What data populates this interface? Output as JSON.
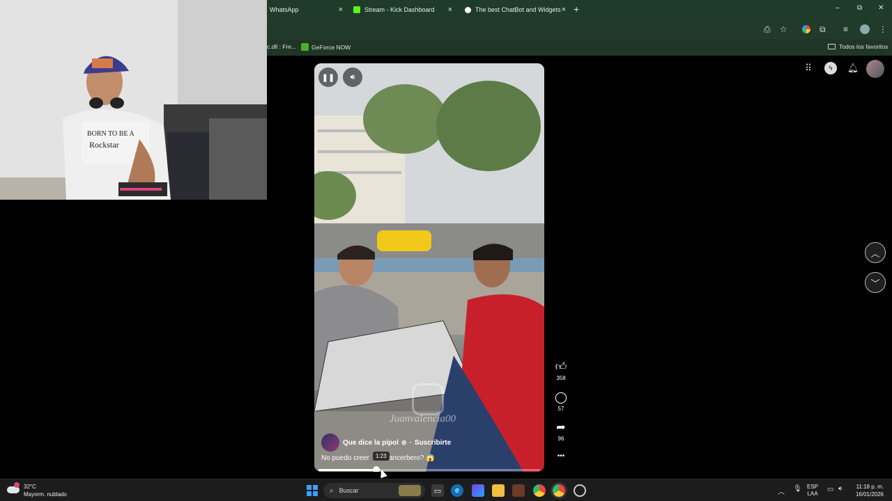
{
  "browser": {
    "tabs": [
      {
        "title": "WhatsApp",
        "close": "×"
      },
      {
        "title": "Stream - Kick Dashboard",
        "close": "×"
      },
      {
        "title": "The best ChatBot and Widgets",
        "close": "×"
      }
    ],
    "new_tab": "+",
    "window_controls": {
      "minimize": "–",
      "maximize": "⧉",
      "close": "✕"
    },
    "bookmarks": [
      {
        "label": "c.dll : Fre..."
      },
      {
        "label": "GeForce NOW"
      }
    ],
    "all_bookmarks": "Todos los favoritos"
  },
  "player": {
    "pause_icon": "pause-icon",
    "volume_icon": "volume-icon",
    "channel_name": "Que dice la pipol",
    "separator": "·",
    "subscribe_label": "Suscribirte",
    "caption_start": "No puedo creer",
    "caption_end": "ancerbero? 😱",
    "time_tooltip": "1:23",
    "watermark": "Juanvalencia00",
    "progress": 0.26
  },
  "actions": {
    "likes": "358",
    "comments": "57",
    "shares": "96",
    "more": "•••"
  },
  "nav": {
    "prev_icon": "chevron-up-icon",
    "next_icon": "chevron-down-icon"
  },
  "taskbar": {
    "temperature": "32°C",
    "weather": "Mayorm. nublado",
    "search_placeholder": "Buscar",
    "language_top": "ESP",
    "language_bottom": "LAA",
    "time": "11:18 p. m.",
    "date": "16/01/2026"
  }
}
